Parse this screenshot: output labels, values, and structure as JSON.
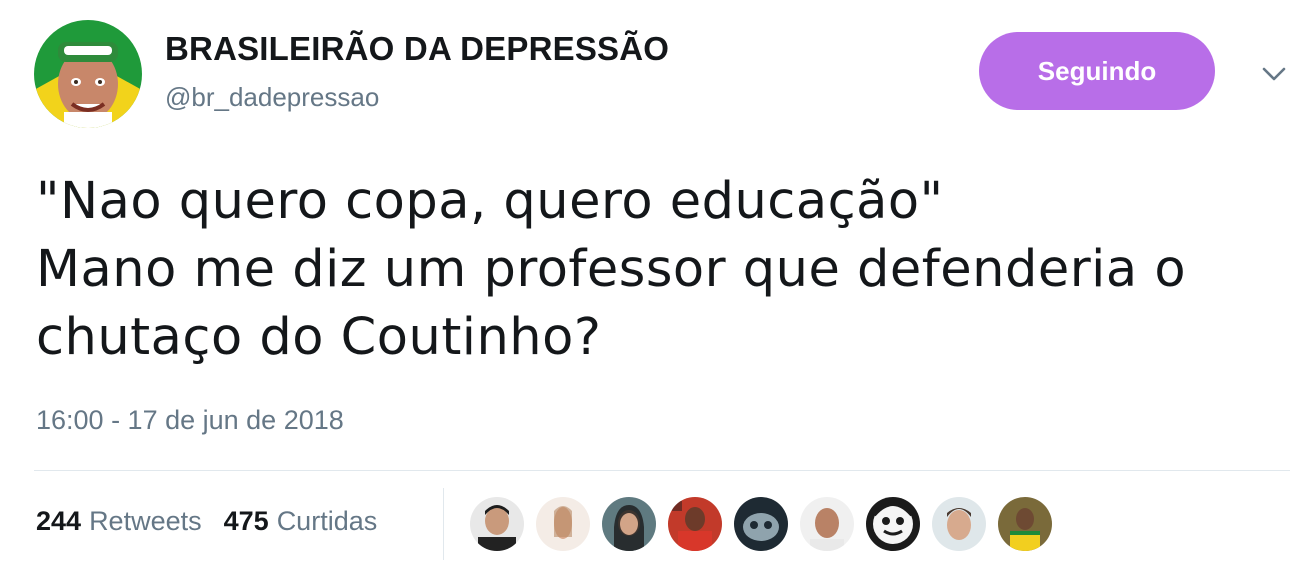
{
  "tweet": {
    "display_name": "BRASILEIRÃO DA DEPRESSÃO",
    "handle": "@br_dadepressao",
    "follow_button_label": "Seguindo",
    "text_lines": [
      "\"Nao quero copa, quero educação\"",
      "Mano me diz um professor que defenderia o",
      "chutaço do Coutinho?"
    ],
    "timestamp": "16:00 - 17 de jun de 2018",
    "retweets_count": "244",
    "retweets_label": "Retweets",
    "likes_count": "475",
    "likes_label": "Curtidas"
  },
  "icons": {
    "caret": "chevron-down-icon"
  },
  "colors": {
    "follow_button": "#b86ee8",
    "secondary_text": "#657786",
    "primary_text": "#14171a"
  }
}
